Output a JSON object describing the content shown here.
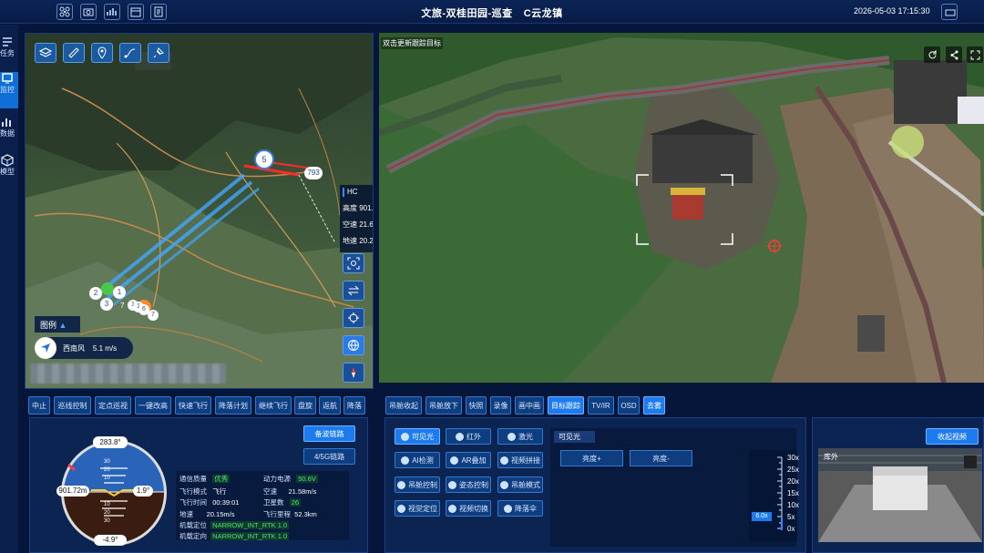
{
  "topbar": {
    "icons": [
      "drone-icon",
      "camera-icon",
      "signal-icon",
      "calendar-icon",
      "document-icon"
    ],
    "title_a": "文旅-双桂田园-巡查",
    "title_b": "C云龙镇",
    "datetime": "2026-05-03 17:15:30"
  },
  "rail": {
    "items": [
      {
        "label": "任务",
        "icon": "task-icon"
      },
      {
        "label": "监控",
        "icon": "monitor-icon",
        "active": true
      },
      {
        "label": "数据",
        "icon": "chart-icon"
      },
      {
        "label": "模型",
        "icon": "cube-icon"
      }
    ]
  },
  "map": {
    "hc": {
      "title": "HC",
      "alt": "高度 901.",
      "speed": "空速 21.6",
      "ground": "地速 20.2"
    },
    "legend": "图例",
    "wind": {
      "dir": "西南风",
      "speed": "5.1 m/s"
    },
    "markers": [
      "5",
      "793",
      "2",
      "1",
      "3",
      "1",
      "7",
      "1",
      "6",
      "7"
    ]
  },
  "video": {
    "label": "双击更新跟踪目标"
  },
  "flight_buttons": [
    "中止",
    "巡线控制",
    "定点巡视",
    "一键改高",
    "快速飞行",
    "降落计划",
    "继续飞行",
    "盘旋",
    "返航",
    "降落"
  ],
  "gimbal_buttons": [
    {
      "label": "吊舱收起"
    },
    {
      "label": "吊舱放下"
    },
    {
      "label": "快照"
    },
    {
      "label": "录像"
    },
    {
      "label": "画中画"
    },
    {
      "label": "目标跟踪",
      "active": true
    },
    {
      "label": "TV/IR"
    },
    {
      "label": "OSD"
    },
    {
      "label": "去雾",
      "active": true
    }
  ],
  "link": {
    "primary": "备波链路",
    "secondary": "4/5G链路"
  },
  "attitude": {
    "heading": "283.8°",
    "altitude": "901.72m",
    "pitch": "1.9°",
    "roll": "-4.9°",
    "ticks": [
      "30",
      "20",
      "10",
      "10",
      "20",
      "30"
    ]
  },
  "telemetry": {
    "rows": [
      {
        "k1": "通信质量",
        "v1": "优秀",
        "g1": true,
        "k2": "动力电源",
        "v2": "50.6V",
        "g2": true
      },
      {
        "k1": "飞行模式",
        "v1": "飞行",
        "k2": "空速",
        "v2": "21.58m/s"
      },
      {
        "k1": "飞行时间",
        "v1": "00:39:01",
        "k2": "卫星数",
        "v2": "26",
        "g2": true
      },
      {
        "k1": "地速",
        "v1": "20.15m/s",
        "k2": "飞行里程",
        "v2": "52.3km"
      },
      {
        "k1": "机载定位",
        "v1": "NARROW_INT_RTK 1.0",
        "g1": true
      },
      {
        "k1": "机载定向",
        "v1": "NARROW_INT_RTK 1.0",
        "g1": true
      }
    ]
  },
  "camera": {
    "modes": [
      {
        "label": "可见光",
        "active": true
      },
      {
        "label": "红外"
      },
      {
        "label": "激光"
      },
      {
        "label": "AI检测"
      },
      {
        "label": "AR叠加"
      },
      {
        "label": "视频拼接"
      },
      {
        "label": "吊舱控制"
      },
      {
        "label": "姿态控制"
      },
      {
        "label": "吊舱模式"
      },
      {
        "label": "视觉定位"
      },
      {
        "label": "视频切换"
      },
      {
        "label": "降落伞"
      }
    ],
    "panel_title": "可见光",
    "bright_up": "亮度+",
    "bright_down": "亮度-",
    "zoom_levels": [
      "30x",
      "25x",
      "20x",
      "15x",
      "10x",
      "5x",
      "0x"
    ],
    "zoom_current": "6.0x"
  },
  "preview": {
    "button": "收起视频",
    "label": "库外"
  }
}
